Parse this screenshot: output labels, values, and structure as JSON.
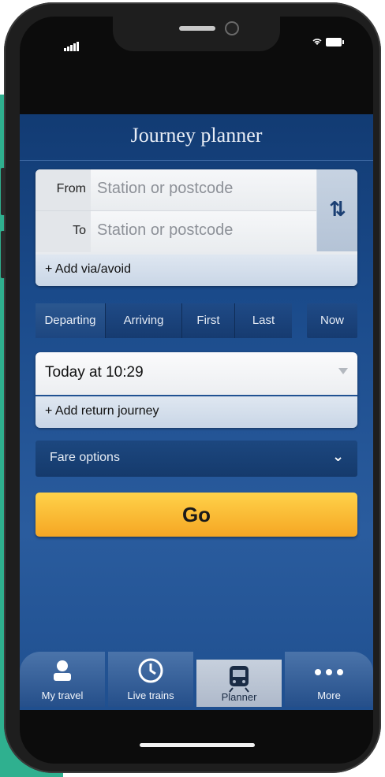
{
  "status_bar": {
    "icons": [
      "signal-icon",
      "wifi-icon",
      "battery-icon"
    ]
  },
  "app": {
    "title": "Journey planner"
  },
  "stations": {
    "from_label": "From",
    "from_placeholder": "Station or postcode",
    "to_label": "To",
    "to_placeholder": "Station or postcode",
    "swap_icon": "swap-arrows-icon",
    "add_via": "+ Add via/avoid"
  },
  "time_mode": {
    "options": [
      "Departing",
      "Arriving",
      "First",
      "Last"
    ],
    "selected": "Departing",
    "now": "Now"
  },
  "date": {
    "value": "Today at 10:29",
    "add_return": "+ Add return journey"
  },
  "fare_options": {
    "label": "Fare options",
    "icon": "chevron-down-icon"
  },
  "go_button": {
    "label": "Go"
  },
  "tabbar": {
    "tabs": [
      {
        "label": "My travel",
        "icon": "person-icon"
      },
      {
        "label": "Live trains",
        "icon": "clock-icon"
      },
      {
        "label": "Planner",
        "icon": "train-icon"
      },
      {
        "label": "More",
        "icon": "more-dots-icon"
      }
    ],
    "selected": "Planner"
  },
  "colors": {
    "accent": "#f5a623",
    "app_bg": "#1a4a8a",
    "side_bg": "#2fb08f"
  }
}
